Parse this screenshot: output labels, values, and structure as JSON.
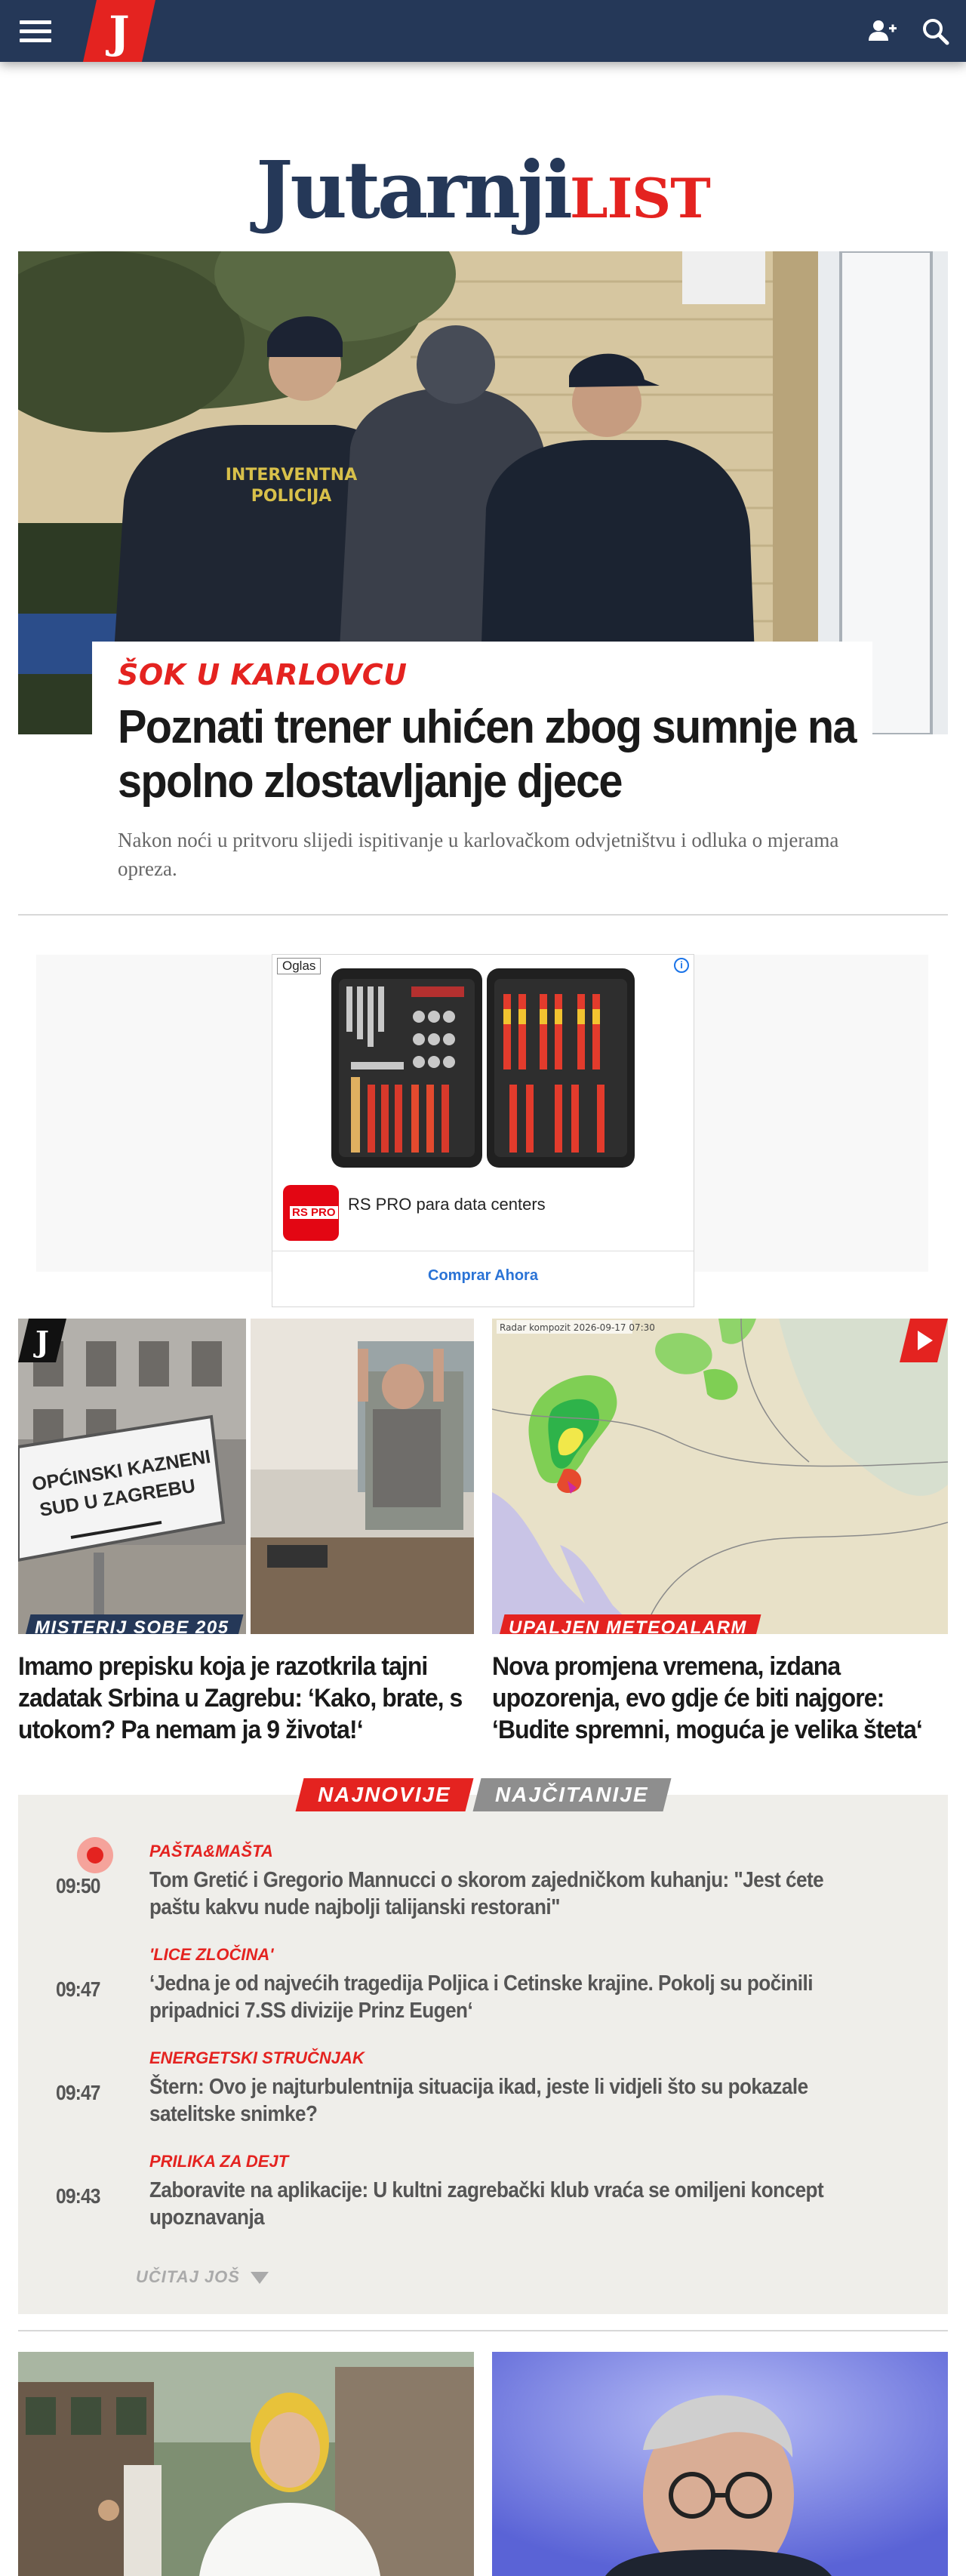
{
  "topbar": {
    "menu_icon": "hamburger-menu-icon",
    "logo_letter": "J",
    "add_user_icon": "add-user-icon",
    "search_icon": "search-icon",
    "colors": {
      "bar": "#253858",
      "logo": "#e42320"
    }
  },
  "masthead": {
    "main": "Jutarnji",
    "sub": "LIST"
  },
  "hero": {
    "kicker": "ŠOK U KARLOVCU",
    "title": "Poznati trener uhićen zbog sumnje na spolno zlostavljanje djece",
    "lead": "Nakon noći u pritvoru slijedi ispitivanje u karlovačkom odvjetništvu i odluka o mjerama opreza.",
    "image_vest_text": [
      "INTERVENTNA",
      "POLICIJA"
    ]
  },
  "ad": {
    "tag": "Oglas",
    "info_icon": "info-icon",
    "brand_logo": "RS PRO",
    "brand": "RS PRO para data centers",
    "cta": "Comprar Ahora"
  },
  "cards": [
    {
      "kicker": "MISTERIJ SOBE 205",
      "kicker_color": "#253858",
      "title": "Imamo prepisku koja je razotkrila tajni zadatak Srbina u Zagrebu: ‘Kako, brate, s utokom? Pa nemam ja 9 života!‘",
      "badge": "J",
      "sign_text": [
        "OPĆINSKI KAZNENI",
        "SUD U ZAGREBU"
      ]
    },
    {
      "kicker": "UPALJEN METEOALARM",
      "kicker_color": "#e42320",
      "title": "Nova promjena vremena, izdana upozorenja, evo gdje će biti najgore: ‘Budite spremni, moguća je velika šteta‘",
      "badge_icon": "play-icon",
      "map_label": "Radar kompozit  2026-09-17  07:30"
    }
  ],
  "latest": {
    "tabs": [
      "NAJNOVIJE",
      "NAJČITANIJE"
    ],
    "items": [
      {
        "time": "09:50",
        "category": "PAŠTA&MAŠTA",
        "title": "Tom Gretić i Gregorio Mannucci o skorom zajedničkom kuhanju: \"Jest ćete paštu kakvu nude najbolji talijanski restorani\"",
        "live": true
      },
      {
        "time": "09:47",
        "category": "'LICE ZLOČINA'",
        "title": "‘Jedna je od najvećih tragedija Poljica i Cetinske krajine. Pokolj su počinili pripadnici 7.SS divizije Prinz Eugen‘",
        "live": false
      },
      {
        "time": "09:47",
        "category": "ENERGETSKI STRUČNJAK",
        "title": "Štern: Ovo je najturbulentnija situacija ikad, jeste li vidjeli što su pokazale satelitske snimke?",
        "live": false
      },
      {
        "time": "09:43",
        "category": "PRILIKA ZA DEJT",
        "title": "Zaboravite na aplikacije: U kultni zagrebački klub vraća se omiljeni koncept upoznavanja",
        "live": false
      }
    ],
    "load_more": "UČITAJ JOŠ"
  }
}
